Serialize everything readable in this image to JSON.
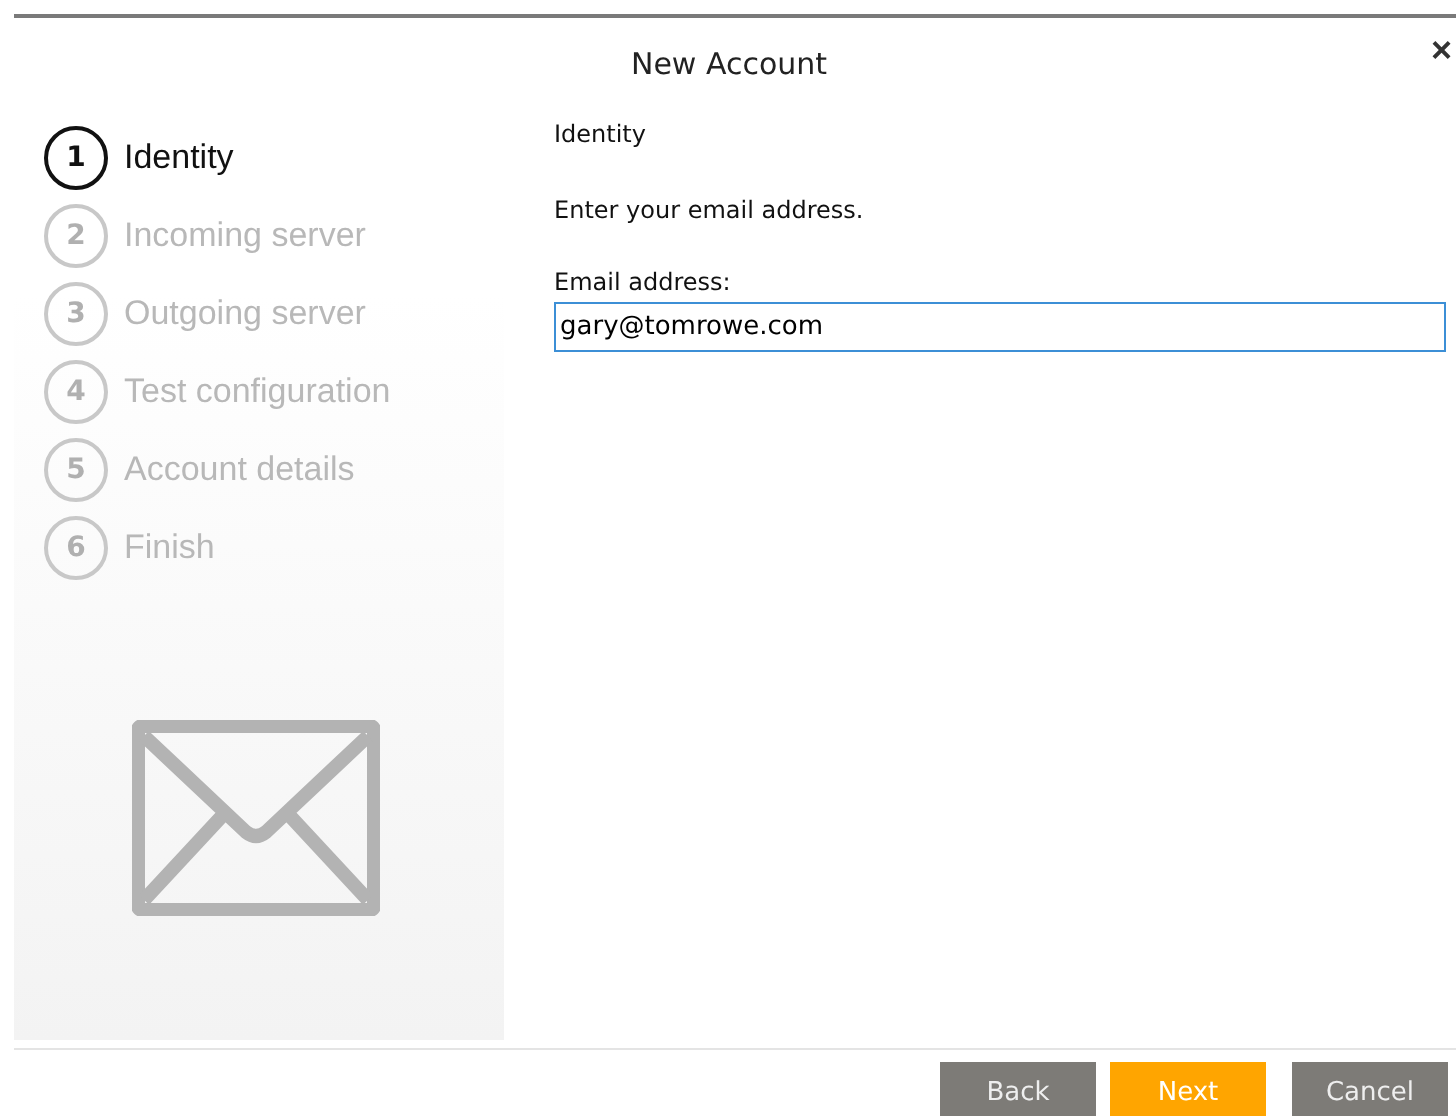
{
  "window": {
    "title": "New Account",
    "close": "×"
  },
  "steps": [
    {
      "number": "1",
      "label": "Identity",
      "selected": true
    },
    {
      "number": "2",
      "label": "Incoming server",
      "selected": false
    },
    {
      "number": "3",
      "label": "Outgoing server",
      "selected": false
    },
    {
      "number": "4",
      "label": "Test configuration",
      "selected": false
    },
    {
      "number": "5",
      "label": "Account details",
      "selected": false
    },
    {
      "number": "6",
      "label": "Finish",
      "selected": false
    }
  ],
  "page": {
    "heading": "Identity",
    "instruction": "Enter your email address.",
    "field_label": "Email address:",
    "value": "gary@tomrowe.com"
  },
  "buttons": [
    {
      "label": "Back",
      "kind": "secondary"
    },
    {
      "label": "Next",
      "kind": "primary"
    },
    {
      "label": "Cancel",
      "kind": "secondary"
    }
  ]
}
